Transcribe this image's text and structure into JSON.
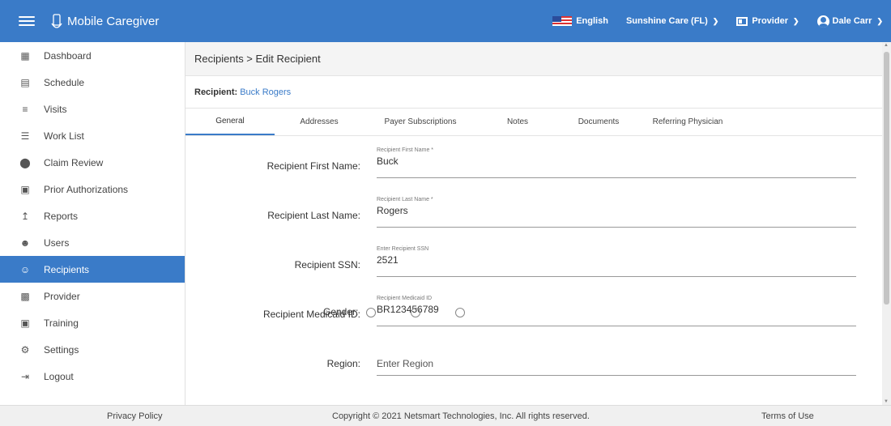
{
  "app": {
    "title": "Mobile Caregiver",
    "logo_icon": "phone-logo-icon"
  },
  "topbar": {
    "language": "English",
    "agency": "Sunshine Care (FL)",
    "role": "Provider",
    "user": "Dale Carr"
  },
  "sidebar": {
    "items": [
      {
        "label": "Dashboard",
        "icon": "dashboard-icon"
      },
      {
        "label": "Schedule",
        "icon": "calendar-icon"
      },
      {
        "label": "Visits",
        "icon": "filter-icon"
      },
      {
        "label": "Work List",
        "icon": "list-icon"
      },
      {
        "label": "Claim Review",
        "icon": "alert-icon"
      },
      {
        "label": "Prior Authorizations",
        "icon": "calendar-check-icon"
      },
      {
        "label": "Reports",
        "icon": "trend-icon"
      },
      {
        "label": "Users",
        "icon": "users-icon"
      },
      {
        "label": "Recipients",
        "icon": "recipients-icon",
        "active": true
      },
      {
        "label": "Provider",
        "icon": "clipboard-icon"
      },
      {
        "label": "Training",
        "icon": "training-icon"
      },
      {
        "label": "Settings",
        "icon": "gear-icon"
      },
      {
        "label": "Logout",
        "icon": "logout-icon"
      }
    ]
  },
  "breadcrumb": "Recipients > Edit Recipient",
  "recipient": {
    "label": "Recipient:",
    "name": "Buck Rogers"
  },
  "tabs": [
    {
      "label": "General",
      "active": true
    },
    {
      "label": "Addresses"
    },
    {
      "label": "Payer Subscriptions"
    },
    {
      "label": "Notes"
    },
    {
      "label": "Documents"
    },
    {
      "label": "Referring Physician"
    }
  ],
  "form": {
    "first_name": {
      "label": "Recipient First Name:",
      "field_label": "Recipient First Name *",
      "value": "Buck"
    },
    "last_name": {
      "label": "Recipient Last Name:",
      "field_label": "Recipient Last Name *",
      "value": "Rogers"
    },
    "ssn": {
      "label": "Recipient SSN:",
      "field_label": "Enter Recipient SSN",
      "value": "2521"
    },
    "medicaid": {
      "label": "Recipient Medicaid ID:",
      "field_label": "Recipient Medicaid ID",
      "value": "BR123456789"
    },
    "region": {
      "label": "Region:",
      "placeholder": "Enter Region"
    },
    "gender": {
      "label": "Gender:"
    }
  },
  "footer": {
    "privacy": "Privacy Policy",
    "copyright": "Copyright © 2021 Netsmart Technologies, Inc. All rights reserved.",
    "terms": "Terms of Use"
  },
  "colors": {
    "primary": "#3a7bc8"
  }
}
